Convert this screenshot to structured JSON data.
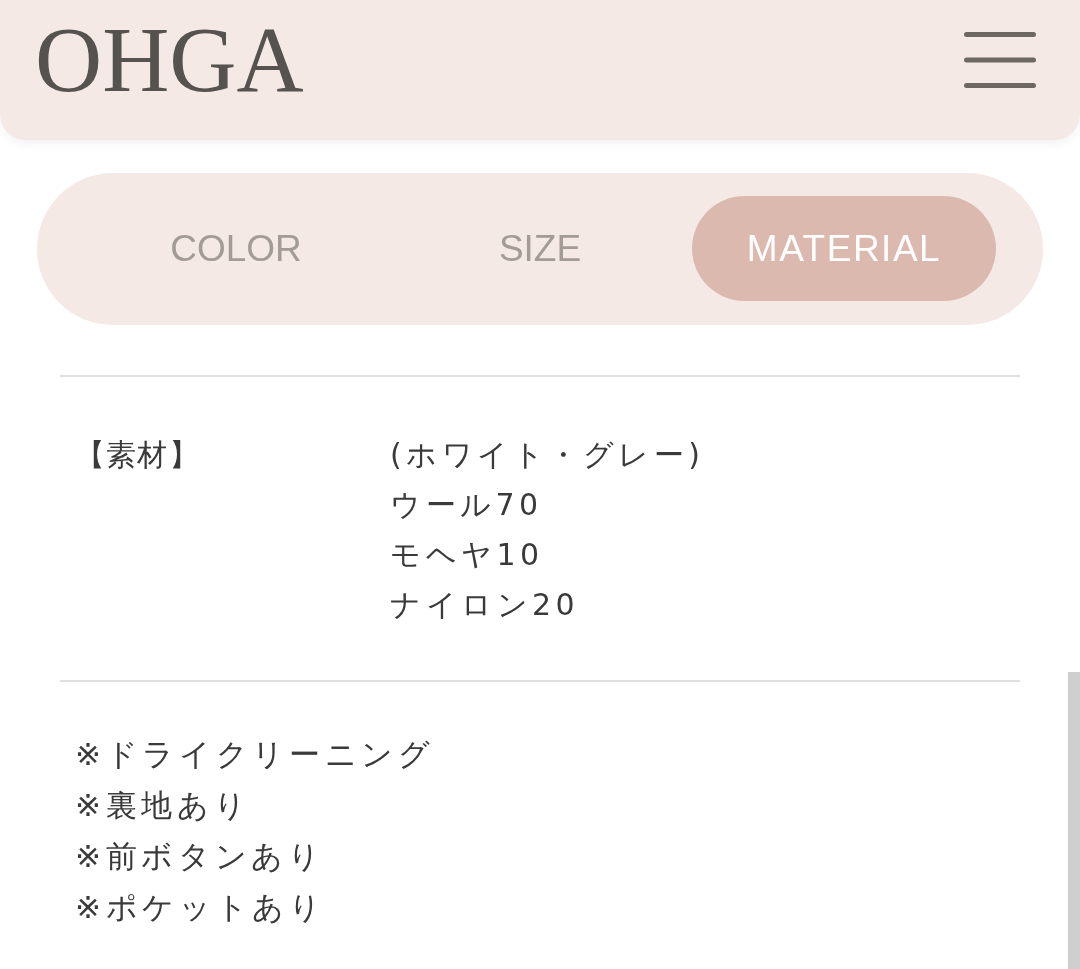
{
  "header": {
    "logo": "OHGA"
  },
  "tabs": [
    {
      "label": "COLOR",
      "selected": false
    },
    {
      "label": "SIZE",
      "selected": false
    },
    {
      "label": "MATERIAL",
      "selected": true
    }
  ],
  "spec": {
    "rows": [
      {
        "label": "【素材】",
        "values": [
          "(ホワイト・グレー)",
          "ウール70",
          "モヘヤ10",
          "ナイロン20"
        ]
      }
    ]
  },
  "notes": [
    "※ドライクリーニング",
    "※裏地あり",
    "※前ボタンあり",
    "※ポケットあり"
  ]
}
